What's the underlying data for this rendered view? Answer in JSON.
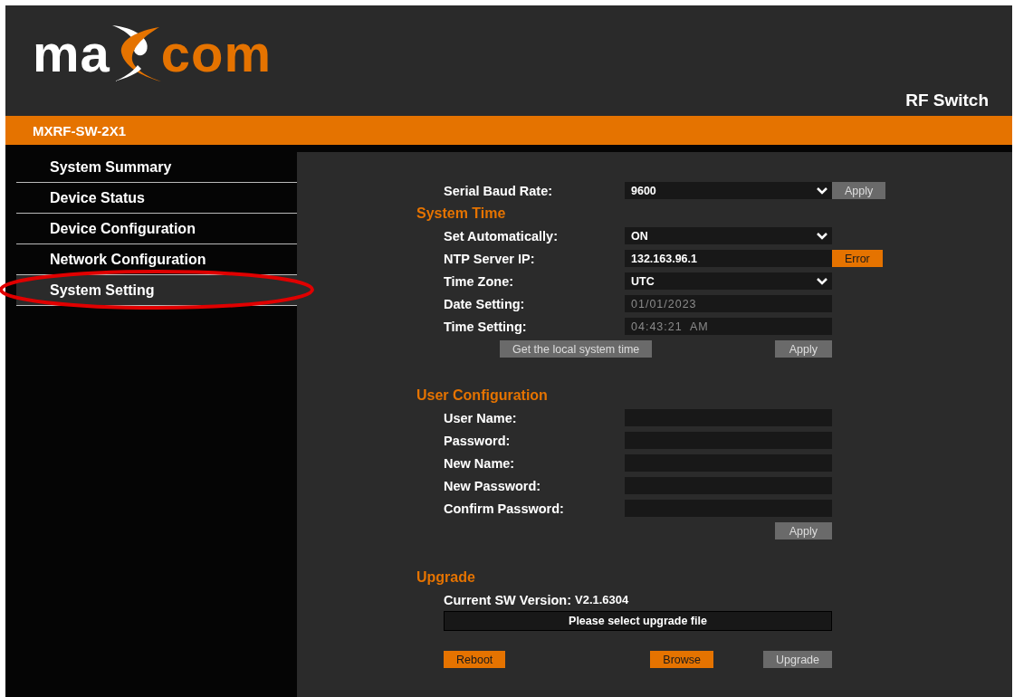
{
  "header": {
    "logo": {
      "left": "ma",
      "right": "com"
    },
    "title": "RF Switch"
  },
  "model_bar": {
    "model": "MXRF-SW-2X1"
  },
  "sidebar": {
    "items": [
      {
        "label": "System Summary",
        "selected": false,
        "circled": false
      },
      {
        "label": "Device Status",
        "selected": false,
        "circled": false
      },
      {
        "label": "Device Configuration",
        "selected": false,
        "circled": false
      },
      {
        "label": "Network Configuration",
        "selected": false,
        "circled": false
      },
      {
        "label": "System Setting",
        "selected": true,
        "circled": true
      }
    ]
  },
  "baud": {
    "label": "Serial Baud Rate:",
    "value": "9600",
    "kind": "select",
    "button": {
      "label": "Apply",
      "accent": false
    }
  },
  "system_time": {
    "title": "System Time",
    "rows": [
      {
        "label": "Set Automatically:",
        "value": "ON",
        "kind": "select"
      },
      {
        "label": "NTP Server IP:",
        "value": "132.163.96.1",
        "kind": "input",
        "button": {
          "label": "Error",
          "accent": true
        }
      },
      {
        "label": "Time Zone:",
        "value": "UTC",
        "kind": "select"
      },
      {
        "label": "Date Setting:",
        "value": "01/01/2023",
        "kind": "readonly"
      },
      {
        "label": "Time Setting:",
        "value": "04:43:21  AM",
        "kind": "readonly"
      }
    ],
    "local_time_button": "Get the local system time",
    "apply": "Apply"
  },
  "user_configuration": {
    "title": "User Configuration",
    "rows": [
      {
        "label": "User Name:"
      },
      {
        "label": "Password:"
      },
      {
        "label": "New Name:"
      },
      {
        "label": "New Password:"
      },
      {
        "label": "Confirm Password:"
      }
    ],
    "apply": "Apply"
  },
  "upgrade": {
    "title": "Upgrade",
    "version_label": "Current SW Version:",
    "version": "V2.1.6304",
    "file_placeholder": "Please select upgrade file",
    "buttons": [
      {
        "label": "Reboot",
        "accent": true
      },
      {
        "label": "Browse",
        "accent": true
      },
      {
        "label": "Upgrade",
        "accent": false
      }
    ]
  }
}
